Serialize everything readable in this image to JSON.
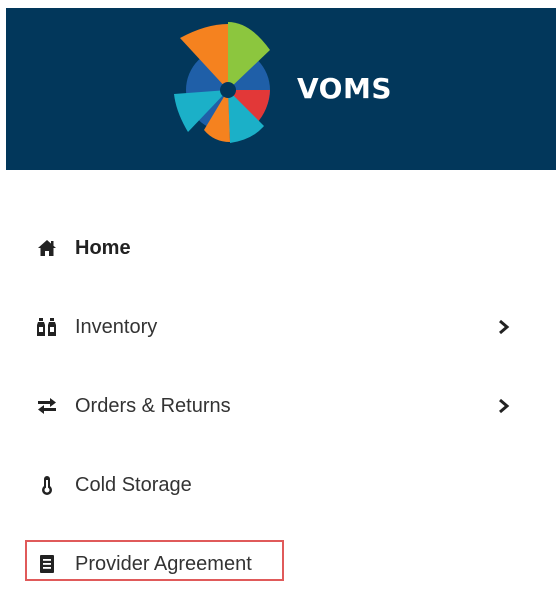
{
  "header": {
    "brand_name": "VOMS",
    "background_color": "#02375b",
    "logo_icon": "voms-pinwheel-logo"
  },
  "nav": {
    "items": [
      {
        "label": "Home",
        "icon": "home-icon",
        "active": true,
        "has_submenu": false
      },
      {
        "label": "Inventory",
        "icon": "bottles-icon",
        "active": false,
        "has_submenu": true
      },
      {
        "label": "Orders & Returns",
        "icon": "exchange-icon",
        "active": false,
        "has_submenu": true
      },
      {
        "label": "Cold Storage",
        "icon": "thermometer-icon",
        "active": false,
        "has_submenu": false
      },
      {
        "label": "Provider Agreement",
        "icon": "document-icon",
        "active": false,
        "has_submenu": false,
        "highlighted": true
      }
    ]
  },
  "colors": {
    "highlight_border": "#e05a5a",
    "text": "#333333",
    "logo_orange": "#f5821f",
    "logo_green": "#8cc63e",
    "logo_blue": "#1f5fa8",
    "logo_red": "#e23838",
    "logo_teal": "#1bb0c8"
  }
}
